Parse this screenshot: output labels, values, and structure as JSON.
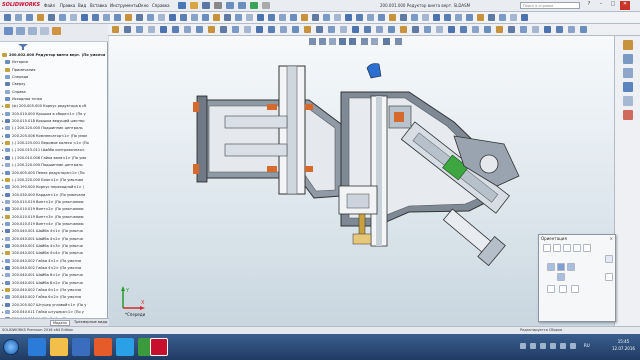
{
  "app": {
    "logo_text": "SOLIDWORKS",
    "menus": [
      "Файл",
      "Правка",
      "Вид",
      "Вставка",
      "Инструменты",
      "Окно",
      "Справка"
    ],
    "document_title": "200.001.000 Редуктор винта верт. SLDASM",
    "search_placeholder": "Поиск в справке",
    "accent_color": "#c8102e"
  },
  "window_buttons": [
    "?",
    "–",
    "□",
    "✕"
  ],
  "feature_tree": {
    "root": "200.002.000 Редуктор винта верт. (По умолча",
    "items": [
      "История",
      "Примечания",
      "Спереди",
      "Сверху",
      "Справа",
      "Исходная точка",
      "(ф) 200.005.000 Корпус редуктора в сб",
      "200.010.000 Крышка в сборе<1> (По у",
      "200.015.018 Крышка ведущей шестер",
      "(-) 200.220.000 Подшипник централь",
      "200.205.006 Компенсатор<1> (По умол",
      "(-) 200.225.001 Ведомое колесо <1> (По",
      "(-) 200.015.011 Шайба контровочная<",
      "(-) 200.010.006 Гайка вала<1> (По умо",
      "(-) 200.220.000 Подшипник централь",
      "200.005.000 Пенек редуктора<1> (По",
      "(-) 200.220.000 Блок<1> (По умолчан",
      "200.190.000 Корпус переходной<1> (",
      "200.030.000 Кардан<1> (По умолчани",
      "200.010.019 Винт<1> (По умолчанию",
      "200.010.019 Винт<2> (По умолчанию",
      "200.010.019 Винт<3> (По умолчанию",
      "200.010.019 Винт<4> (По умолчанию",
      "200.040.001 Шайба 4<1> (По умолча",
      "200.040.001 Шайба 4<2> (По умолча",
      "200.040.001 Шайба 4<3> (По умолча",
      "200.040.001 Шайба 4<4> (По умолча",
      "200.040.002 Гайка 4<1> (По умолча",
      "200.040.002 Гайка 4<2> (По умолча",
      "200.040.001 Шайба 6<1> (По умолча",
      "200.040.001 Шайба 6<2> (По умолча",
      "200.040.002 Гайка 6<1> (По умолча",
      "200.040.002 Гайка 6<2> (По умолча",
      "200.205.007 Штуцер угловой<1> (По у",
      "200.040.011 Гайка штуцера<1> (По у",
      "200.040.001 Шайба 8<1> (По умолча",
      "200.059.005 Шайба 8<2> (По умолча",
      "200.059.005 Шайба 8<3> (По умолча"
    ]
  },
  "bottom_tabs": [
    "Модель",
    "Трехмерные виды",
    "Анимация1"
  ],
  "viewport": {
    "view_label": "*Спереди",
    "triad_labels": [
      "X",
      "Y"
    ]
  },
  "orientation_dialog": {
    "title": "Ориентация",
    "close": "×"
  },
  "status": {
    "left": "SOLIDWORKS Premium 2016 x64 Edition",
    "right": "Редактируется Сборка"
  },
  "taskbar": {
    "time": "15:45",
    "date": "12.07.2016",
    "lang": "RU"
  }
}
